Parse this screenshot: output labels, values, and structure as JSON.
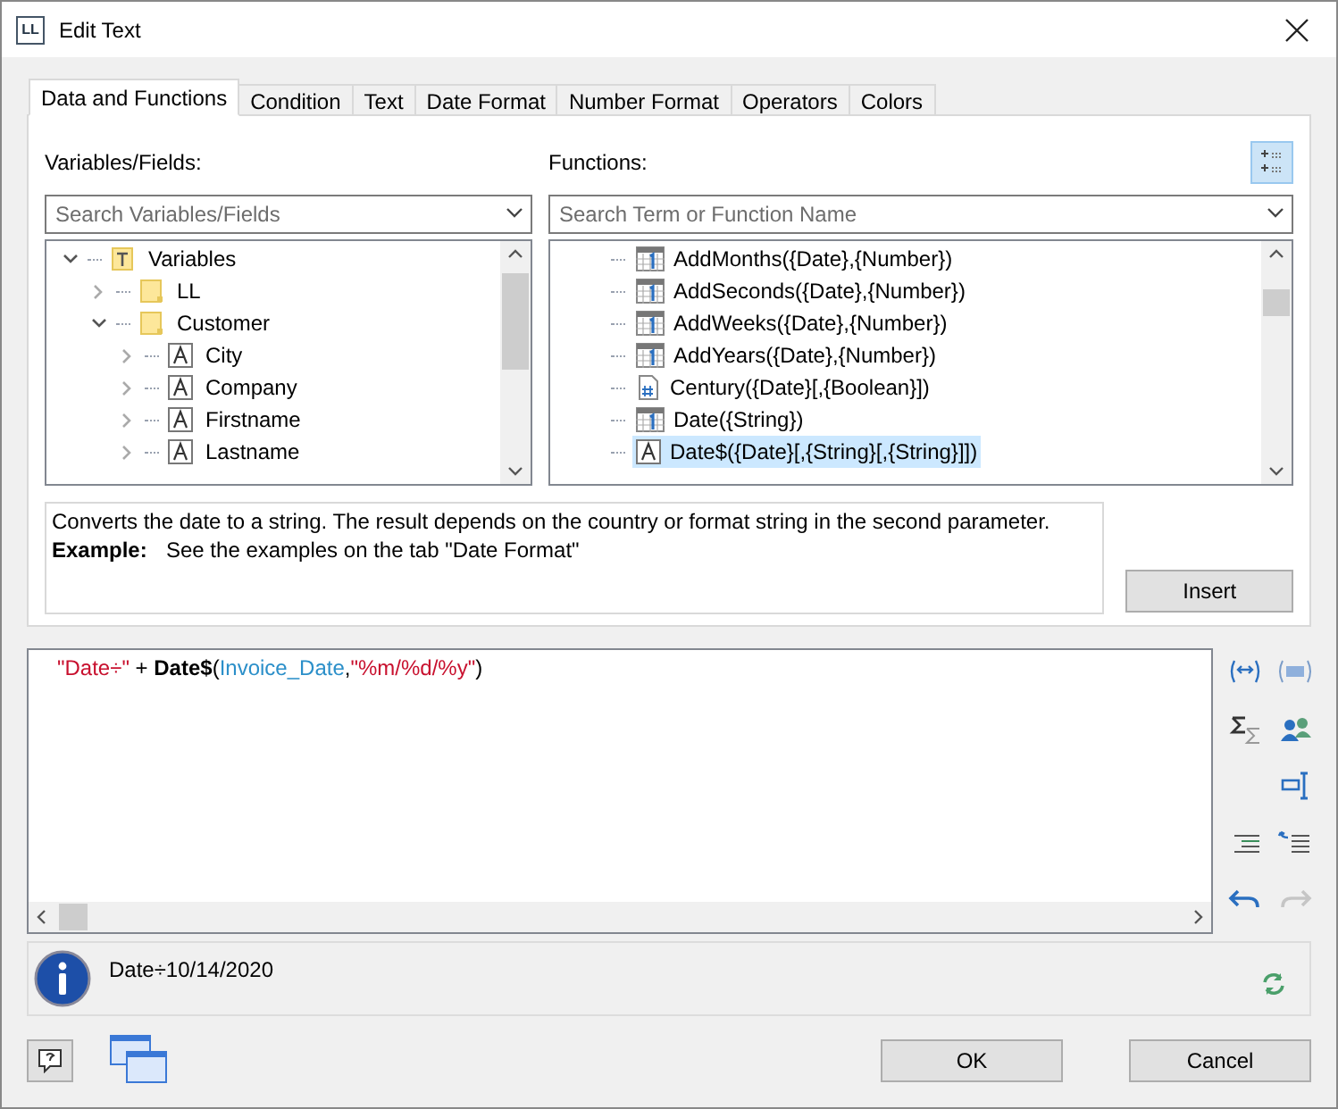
{
  "window": {
    "title": "Edit Text",
    "logo": "LL"
  },
  "tabs": [
    {
      "label": "Data and Functions",
      "selected": true
    },
    {
      "label": "Condition",
      "selected": false
    },
    {
      "label": "Text",
      "selected": false
    },
    {
      "label": "Date Format",
      "selected": false
    },
    {
      "label": "Number Format",
      "selected": false
    },
    {
      "label": "Operators",
      "selected": false
    },
    {
      "label": "Colors",
      "selected": false
    }
  ],
  "variables": {
    "label": "Variables/Fields:",
    "search_placeholder": "Search Variables/Fields",
    "tree": [
      {
        "label": "Variables",
        "kind": "root",
        "expanded": true,
        "children": [
          {
            "label": "LL",
            "kind": "folder",
            "expanded": false
          },
          {
            "label": "Customer",
            "kind": "folder",
            "expanded": true,
            "children": [
              {
                "label": "City",
                "kind": "text",
                "expanded": false
              },
              {
                "label": "Company",
                "kind": "text",
                "expanded": false
              },
              {
                "label": "Firstname",
                "kind": "text",
                "expanded": false
              },
              {
                "label": "Lastname",
                "kind": "text",
                "expanded": false
              }
            ]
          }
        ]
      }
    ]
  },
  "functions": {
    "label": "Functions:",
    "search_placeholder": "Search Term or Function Name",
    "items": [
      {
        "label": "AddMonths({Date},{Number})",
        "kind": "date",
        "selected": false
      },
      {
        "label": "AddSeconds({Date},{Number})",
        "kind": "date",
        "selected": false
      },
      {
        "label": "AddWeeks({Date},{Number})",
        "kind": "date",
        "selected": false
      },
      {
        "label": "AddYears({Date},{Number})",
        "kind": "date",
        "selected": false
      },
      {
        "label": "Century({Date}[,{Boolean}])",
        "kind": "number",
        "selected": false
      },
      {
        "label": "Date({String})",
        "kind": "date",
        "selected": false
      },
      {
        "label": "Date$({Date}[,{String}[,{String}]])",
        "kind": "text",
        "selected": true
      }
    ]
  },
  "description": {
    "text": "Converts the date to a string. The result depends on the country or format string in the second parameter.",
    "example_label": "Example:",
    "example": "See the examples on the tab \"Date Format\""
  },
  "insert_button": "Insert",
  "expression": [
    {
      "text": "\"Date÷\"",
      "kind": "string"
    },
    {
      "text": " + ",
      "kind": "plain"
    },
    {
      "text": "Date$",
      "kind": "function"
    },
    {
      "text": "(",
      "kind": "plain"
    },
    {
      "text": "Invoice_Date",
      "kind": "variable"
    },
    {
      "text": ",",
      "kind": "plain"
    },
    {
      "text": "\"%m/%d/%y\"",
      "kind": "string"
    },
    {
      "text": ")",
      "kind": "plain"
    }
  ],
  "result": "Date÷10/14/2020",
  "buttons": [
    {
      "label": "OK"
    },
    {
      "label": "Cancel"
    }
  ]
}
